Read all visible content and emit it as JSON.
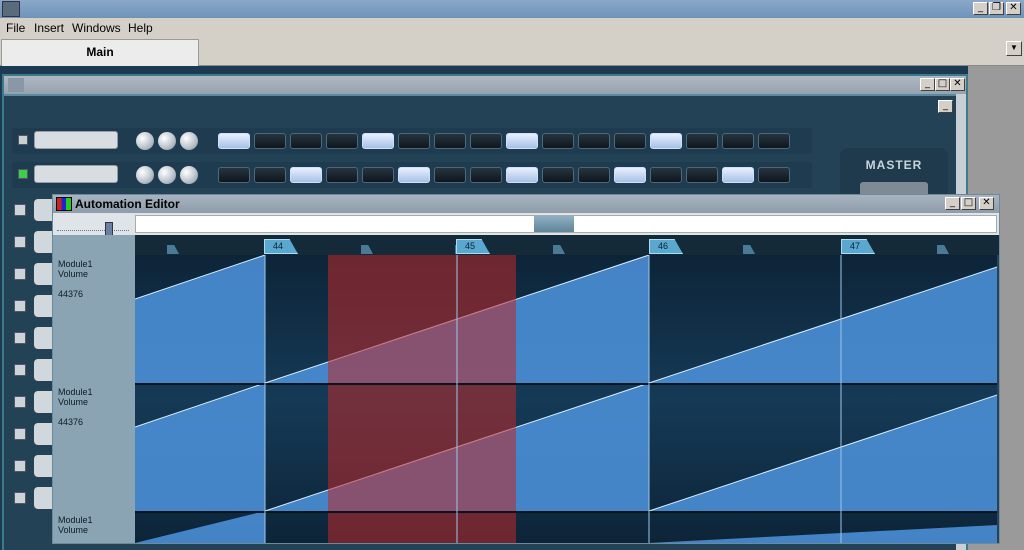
{
  "menu": {
    "file": "File",
    "insert": "Insert",
    "windows": "Windows",
    "help": "Help"
  },
  "tabs": [
    {
      "label": "Main"
    }
  ],
  "rack": {
    "master_label": "MASTER"
  },
  "automation_editor": {
    "title": "Automation Editor",
    "bars": [
      "44",
      "45",
      "46",
      "47"
    ],
    "lanes": [
      {
        "module": "Module1",
        "param": "Volume",
        "value": "44376"
      },
      {
        "module": "Module1",
        "param": "Volume",
        "value": "44376"
      },
      {
        "module": "Module1",
        "param": "Volume",
        "value": ""
      }
    ]
  },
  "colors": {
    "lane_bg": "#0e2a3e",
    "automation_fill": "#4a8fd6",
    "selection": "#c02828",
    "selection_overlay": "#e898dc"
  },
  "icons": [
    "minimize-icon",
    "restore-icon",
    "close-icon",
    "chevron-down-icon"
  ]
}
